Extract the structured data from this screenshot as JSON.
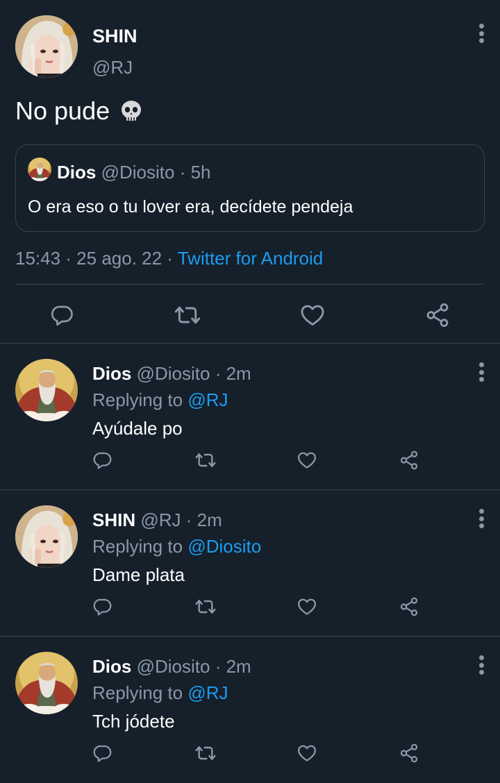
{
  "main_tweet": {
    "author_name": "SHIN",
    "author_handle": "@RJ",
    "text": "No pude",
    "emoji": "skull-emoji",
    "quote": {
      "author_name": "Dios",
      "author_handle": "@Diosito",
      "separator": "·",
      "time": "5h",
      "text": "O era eso o tu lover era, decídete pendeja"
    },
    "timestamp": "15:43 · 25 ago. 22 ·",
    "source": "Twitter for Android",
    "actions": [
      "reply-icon",
      "retweet-icon",
      "like-icon",
      "share-icon"
    ]
  },
  "replies": [
    {
      "author_name": "Dios",
      "author_handle": "@Diosito",
      "time": "· 2m",
      "replying_prefix": "Replying to",
      "replying_to": "@RJ",
      "text": "Ayúdale po",
      "avatar": "dios"
    },
    {
      "author_name": "SHIN",
      "author_handle": "@RJ",
      "time": "· 2m",
      "replying_prefix": "Replying to",
      "replying_to": "@Diosito",
      "text": "Dame plata",
      "avatar": "shin"
    },
    {
      "author_name": "Dios",
      "author_handle": "@Diosito",
      "time": "· 2m",
      "replying_prefix": "Replying to",
      "replying_to": "@RJ",
      "text": "Tch jódete",
      "avatar": "dios"
    }
  ],
  "colors": {
    "background": "#15202b",
    "secondary_text": "#8b98a5",
    "accent": "#1d9bf0",
    "border": "#38444d"
  }
}
